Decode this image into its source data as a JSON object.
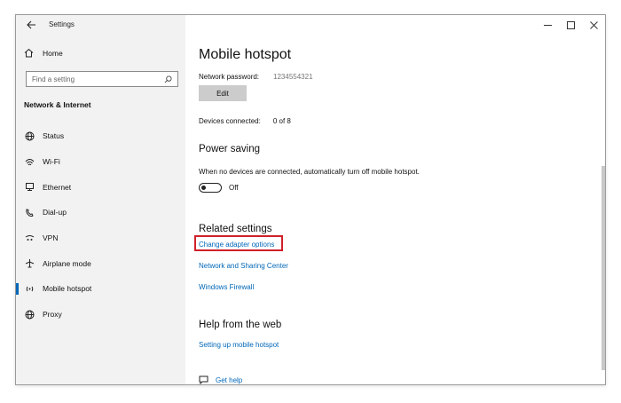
{
  "window": {
    "title": "Settings",
    "controls": [
      "minimize",
      "maximize",
      "close"
    ]
  },
  "sidebar": {
    "home_label": "Home",
    "search_placeholder": "Find a setting",
    "section_title": "Network & Internet",
    "items": [
      {
        "label": "Status",
        "icon": "globe-icon"
      },
      {
        "label": "Wi-Fi",
        "icon": "wifi-icon"
      },
      {
        "label": "Ethernet",
        "icon": "ethernet-icon"
      },
      {
        "label": "Dial-up",
        "icon": "dial-up-icon"
      },
      {
        "label": "VPN",
        "icon": "vpn-icon"
      },
      {
        "label": "Airplane mode",
        "icon": "airplane-icon"
      },
      {
        "label": "Mobile hotspot",
        "icon": "hotspot-icon",
        "active": true
      },
      {
        "label": "Proxy",
        "icon": "globe-icon"
      }
    ]
  },
  "main": {
    "title": "Mobile hotspot",
    "password_label": "Network password:",
    "password_value": "1234554321",
    "edit_label": "Edit",
    "devices_label": "Devices connected:",
    "devices_value": "0 of 8",
    "power_saving": {
      "heading": "Power saving",
      "description": "When no devices are connected, automatically turn off mobile hotspot.",
      "toggle_state": "Off"
    },
    "related": {
      "heading": "Related settings",
      "links": [
        "Change adapter options",
        "Network and Sharing Center",
        "Windows Firewall"
      ]
    },
    "help": {
      "heading": "Help from the web",
      "link": "Setting up mobile hotspot",
      "get_help": "Get help"
    }
  },
  "colors": {
    "accent": "#0067b8",
    "highlight_box": "#d0202a",
    "sidebar_bg": "#f2f2f2"
  }
}
